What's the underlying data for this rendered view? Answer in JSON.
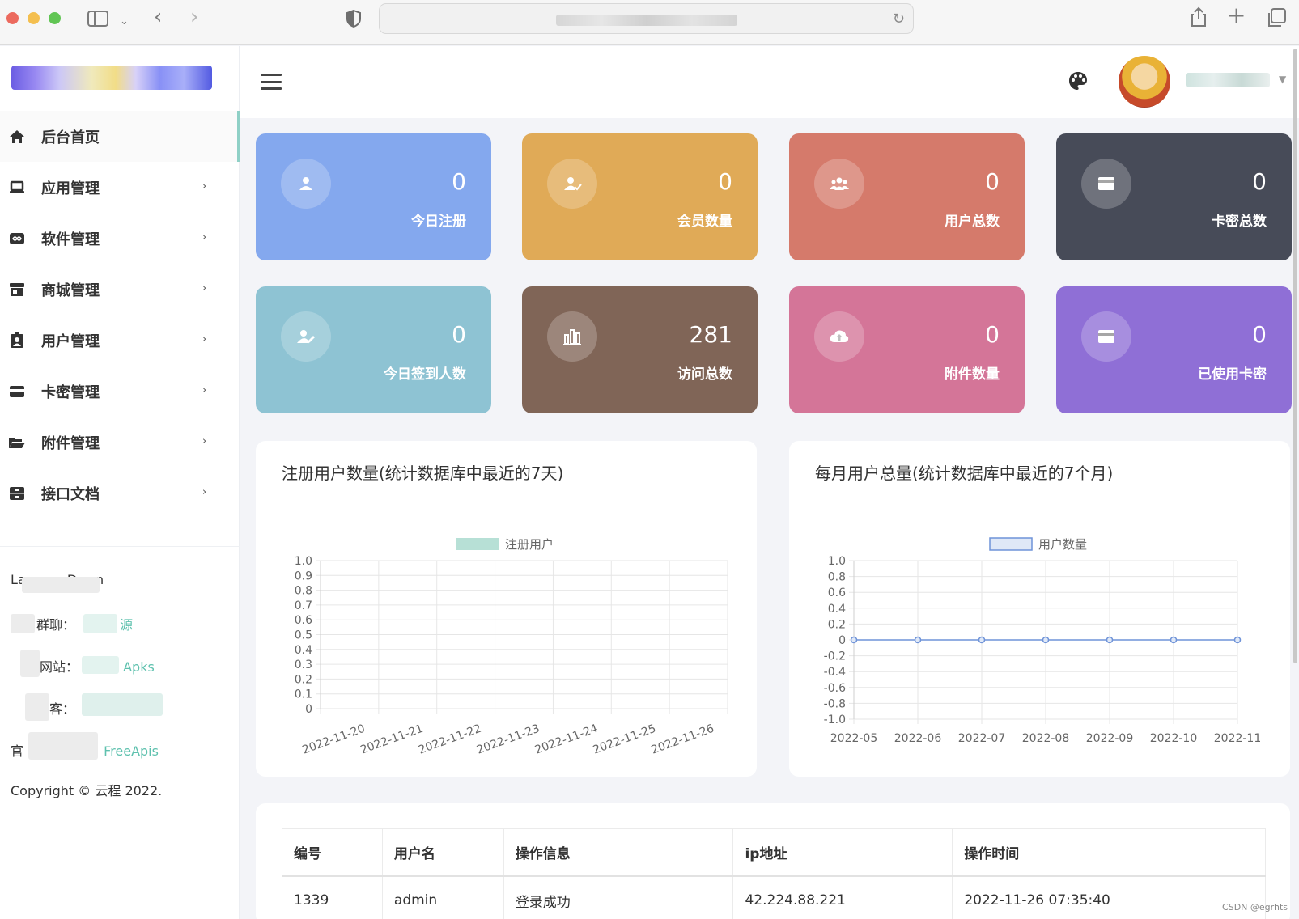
{
  "browser": {
    "icons": [
      "sidebar-toggle-icon",
      "chevron-down-icon",
      "back-icon",
      "forward-icon",
      "shield-icon",
      "reload-icon",
      "share-icon",
      "new-tab-icon",
      "tabs-overview-icon"
    ]
  },
  "sidebar": {
    "items": [
      {
        "label": "后台首页",
        "icon": "home-icon",
        "active": true
      },
      {
        "label": "应用管理",
        "icon": "laptop-icon"
      },
      {
        "label": "软件管理",
        "icon": "infinity-icon"
      },
      {
        "label": "商城管理",
        "icon": "store-icon"
      },
      {
        "label": "用户管理",
        "icon": "id-badge-icon"
      },
      {
        "label": "卡密管理",
        "icon": "credit-card-icon"
      },
      {
        "label": "附件管理",
        "icon": "folder-open-icon"
      },
      {
        "label": "接口文档",
        "icon": "archive-icon"
      }
    ],
    "info": [
      {
        "key": "La",
        "value": "Down"
      },
      {
        "key": "群聊：",
        "value": "源"
      },
      {
        "key": "网站：",
        "value": "Apks"
      },
      {
        "key": "客：",
        "value": ""
      },
      {
        "key": "官",
        "value": "FreeApis"
      }
    ],
    "copyright": "Copyright © 云程 2022."
  },
  "stats": [
    {
      "value": "0",
      "label": "今日注册",
      "color": "#84a8ee",
      "icon": "user-icon"
    },
    {
      "value": "0",
      "label": "会员数量",
      "color": "#e0aa57",
      "icon": "user-check-icon"
    },
    {
      "value": "0",
      "label": "用户总数",
      "color": "#d57a6b",
      "icon": "users-icon"
    },
    {
      "value": "0",
      "label": "卡密总数",
      "color": "#474b58",
      "icon": "card-icon"
    },
    {
      "value": "0",
      "label": "今日签到人数",
      "color": "#8ec3d3",
      "icon": "user-edit-icon"
    },
    {
      "value": "281",
      "label": "访问总数",
      "color": "#806557",
      "icon": "bar-chart-icon"
    },
    {
      "value": "0",
      "label": "附件数量",
      "color": "#d47598",
      "icon": "cloud-upload-icon"
    },
    {
      "value": "0",
      "label": "已使用卡密",
      "color": "#8f6fd6",
      "icon": "card-icon"
    }
  ],
  "chart_data": [
    {
      "type": "bar",
      "title": "注册用户数量(统计数据库中最近的7天)",
      "categories": [
        "2022-11-20",
        "2022-11-21",
        "2022-11-22",
        "2022-11-23",
        "2022-11-24",
        "2022-11-25",
        "2022-11-26"
      ],
      "series": [
        {
          "name": "注册用户",
          "values": [
            0,
            0,
            0,
            0,
            0,
            0,
            0
          ],
          "color": "#b7e0d6"
        }
      ],
      "yticks": [
        "1.0",
        "0.9",
        "0.8",
        "0.7",
        "0.6",
        "0.5",
        "0.4",
        "0.3",
        "0.2",
        "0.1",
        "0"
      ],
      "ylim": [
        0,
        1
      ],
      "grid": true,
      "legend": "top-center"
    },
    {
      "type": "line",
      "title": "每月用户总量(统计数据库中最近的7个月)",
      "categories": [
        "2022-05",
        "2022-06",
        "2022-07",
        "2022-08",
        "2022-09",
        "2022-10",
        "2022-11"
      ],
      "series": [
        {
          "name": "用户数量",
          "values": [
            0,
            0,
            0,
            0,
            0,
            0,
            0
          ],
          "color": "#6f93d8"
        }
      ],
      "yticks": [
        "1.0",
        "0.8",
        "0.6",
        "0.4",
        "0.2",
        "0",
        "-0.2",
        "-0.4",
        "-0.6",
        "-0.8",
        "-1.0"
      ],
      "ylim": [
        -1,
        1
      ],
      "grid": true,
      "legend": "top-center"
    }
  ],
  "table": {
    "headers": [
      "编号",
      "用户名",
      "操作信息",
      "ip地址",
      "操作时间"
    ],
    "rows": [
      [
        "1339",
        "admin",
        "登录成功",
        "42.224.88.221",
        "2022-11-26 07:35:40"
      ]
    ]
  },
  "watermark": "CSDN @egrhts"
}
